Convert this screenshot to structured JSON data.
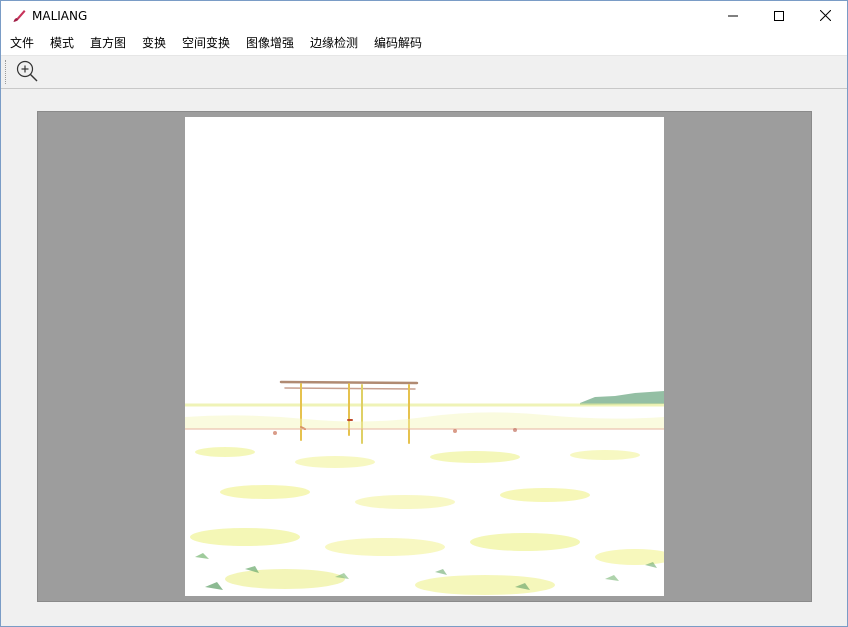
{
  "window": {
    "title": "MALIANG",
    "icon": "paintbrush-icon",
    "controls": {
      "minimize": "minimize-icon",
      "maximize": "maximize-icon",
      "close": "close-icon"
    }
  },
  "menubar": {
    "items": [
      {
        "label": "文件"
      },
      {
        "label": "模式"
      },
      {
        "label": "直方图"
      },
      {
        "label": "变换"
      },
      {
        "label": "空间变换"
      },
      {
        "label": "图像增强"
      },
      {
        "label": "边缘检测"
      },
      {
        "label": "编码解码"
      }
    ]
  },
  "toolbar": {
    "tools": [
      {
        "icon": "zoom-in-icon"
      }
    ]
  },
  "canvas": {
    "background_color": "#9d9d9d",
    "image": {
      "subject": "processed-photo-field-with-swing-set",
      "background_color": "#ffffff"
    }
  }
}
